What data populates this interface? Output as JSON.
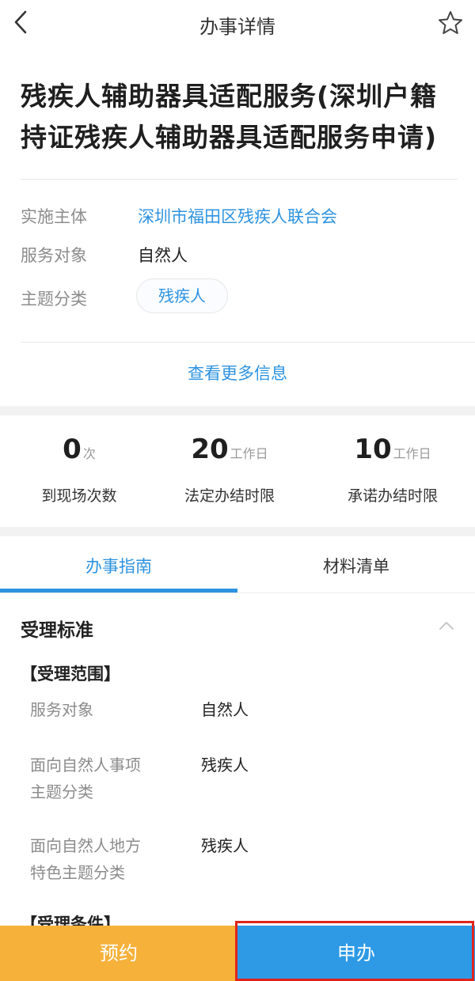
{
  "header": {
    "title": "办事详情",
    "back_icon": "chevron-left-icon",
    "favorite_icon": "star-outline-icon"
  },
  "service": {
    "title_line1": "残疾人辅助器具适配服务(深圳户籍",
    "title_line2": "持证残疾人辅助器具适配服务申请)"
  },
  "info": {
    "implementer_label": "实施主体",
    "implementer_value": "深圳市福田区残疾人联合会",
    "target_label": "服务对象",
    "target_value": "自然人",
    "category_label": "主题分类",
    "category_tag": "残疾人",
    "more_link": "查看更多信息"
  },
  "stats": [
    {
      "value": "0",
      "unit": "次",
      "label": "到现场次数"
    },
    {
      "value": "20",
      "unit": "工作日",
      "label": "法定办结时限"
    },
    {
      "value": "10",
      "unit": "工作日",
      "label": "承诺办结时限"
    }
  ],
  "tabs": [
    {
      "label": "办事指南",
      "active": true
    },
    {
      "label": "材料清单",
      "active": false
    }
  ],
  "section": {
    "title": "受理标准",
    "subsection": "【受理范围】",
    "rows": [
      {
        "label": "服务对象",
        "value": "自然人"
      },
      {
        "label_line1": "面向自然人事项",
        "label_line2": "主题分类",
        "value": "残疾人"
      },
      {
        "label_line1": "面向自然人地方",
        "label_line2": "特色主题分类",
        "value": "残疾人"
      }
    ],
    "next_subsection": "【受理条件】"
  },
  "bottom_bar": {
    "appoint_label": "预约",
    "apply_label": "申办"
  },
  "colors": {
    "accent": "#2e93e0",
    "appoint": "#f6b13a",
    "apply": "#2e9ae6",
    "highlight": "#e0241b"
  }
}
